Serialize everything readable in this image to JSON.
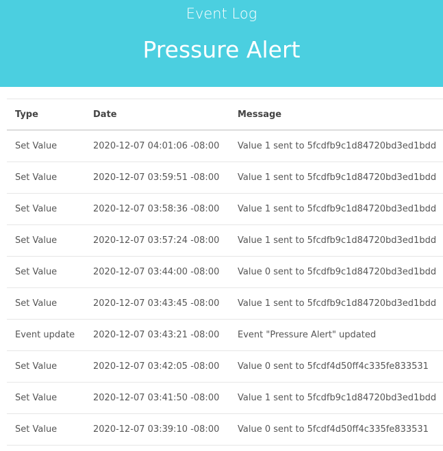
{
  "header": {
    "subtitle": "Event Log",
    "title": "Pressure Alert"
  },
  "table": {
    "columns": [
      "Type",
      "Date",
      "Message"
    ],
    "rows": [
      {
        "type": "Set Value",
        "date": "2020-12-07 04:01:06 -08:00",
        "message": "Value 1 sent to 5fcdfb9c1d84720bd3ed1bdd"
      },
      {
        "type": "Set Value",
        "date": "2020-12-07 03:59:51 -08:00",
        "message": "Value 1 sent to 5fcdfb9c1d84720bd3ed1bdd"
      },
      {
        "type": "Set Value",
        "date": "2020-12-07 03:58:36 -08:00",
        "message": "Value 1 sent to 5fcdfb9c1d84720bd3ed1bdd"
      },
      {
        "type": "Set Value",
        "date": "2020-12-07 03:57:24 -08:00",
        "message": "Value 1 sent to 5fcdfb9c1d84720bd3ed1bdd"
      },
      {
        "type": "Set Value",
        "date": "2020-12-07 03:44:00 -08:00",
        "message": "Value 0 sent to 5fcdfb9c1d84720bd3ed1bdd"
      },
      {
        "type": "Set Value",
        "date": "2020-12-07 03:43:45 -08:00",
        "message": "Value 1 sent to 5fcdfb9c1d84720bd3ed1bdd"
      },
      {
        "type": "Event update",
        "date": "2020-12-07 03:43:21 -08:00",
        "message": "Event \"Pressure Alert\" updated"
      },
      {
        "type": "Set Value",
        "date": "2020-12-07 03:42:05 -08:00",
        "message": "Value 0 sent to 5fcdf4d50ff4c335fe833531"
      },
      {
        "type": "Set Value",
        "date": "2020-12-07 03:41:50 -08:00",
        "message": "Value 1 sent to 5fcdfb9c1d84720bd3ed1bdd"
      },
      {
        "type": "Set Value",
        "date": "2020-12-07 03:39:10 -08:00",
        "message": "Value 0 sent to 5fcdf4d50ff4c335fe833531"
      }
    ]
  },
  "colors": {
    "header_bg": "#4bcfe0",
    "header_text": "#ffffff"
  }
}
